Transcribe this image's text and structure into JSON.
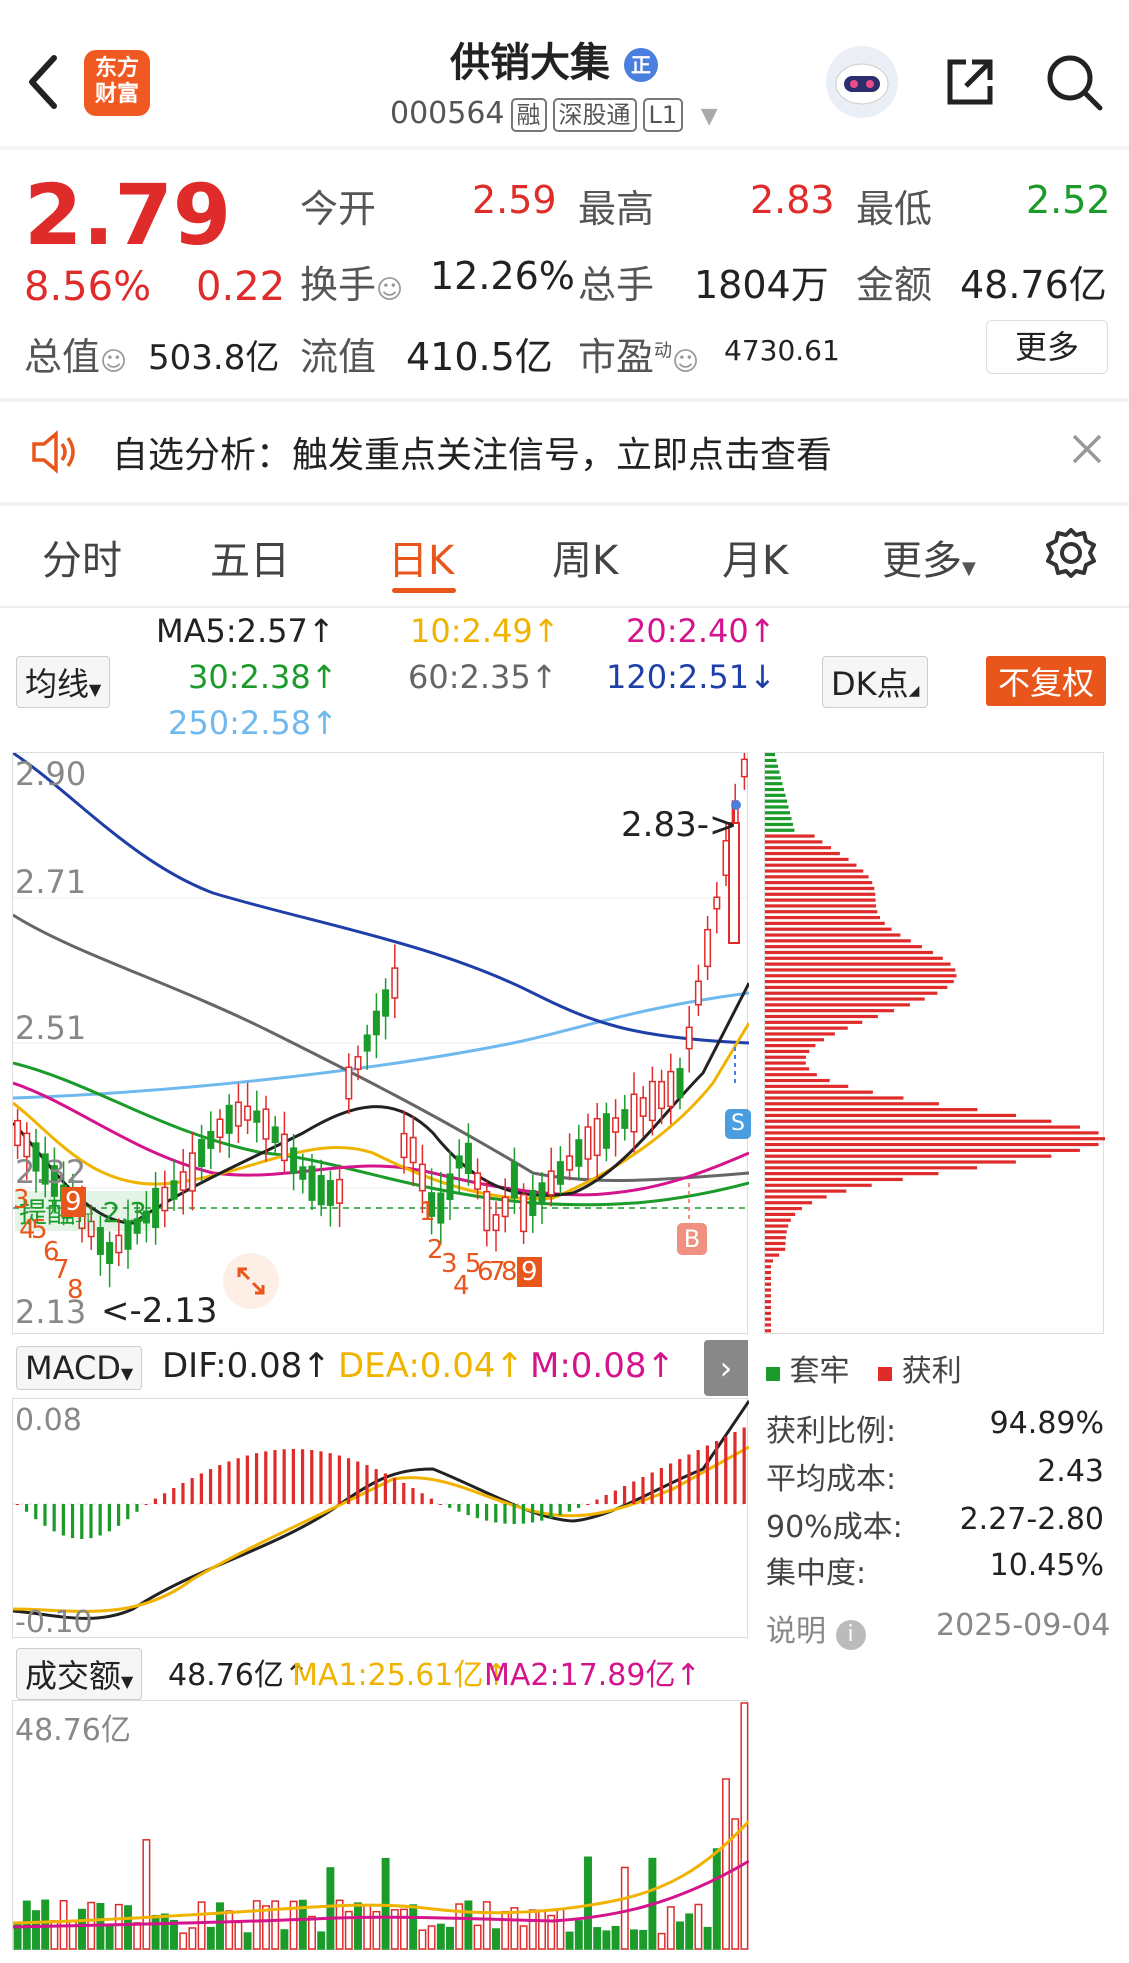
{
  "header": {
    "back_icon": "chevron-left-icon",
    "logo_text_1": "东方",
    "logo_text_2": "财富",
    "title": "供销大集",
    "title_badge": "正",
    "code": "000564",
    "tags": [
      "融",
      "深股通",
      "L1"
    ],
    "share_icon": "share-icon",
    "search_icon": "search-icon"
  },
  "quote": {
    "price": "2.79",
    "change_pct": "8.56%",
    "change": "0.22",
    "open_label": "今开",
    "open": "2.59",
    "high_label": "最高",
    "high": "2.83",
    "low_label": "最低",
    "low": "2.52",
    "turnover_label": "换手",
    "turnover": "12.26%",
    "volume_label": "总手",
    "volume": "1804万",
    "amount_label": "金额",
    "amount": "48.76亿",
    "mktcap_label": "总值",
    "mktcap": "503.8亿",
    "float_label": "流值",
    "float": "410.5亿",
    "pe_label": "市盈",
    "pe_sup": "动",
    "pe": "4730.61",
    "more": "更多"
  },
  "notice": {
    "text": "自选分析：触发重点关注信号，立即点击查看"
  },
  "tabs": [
    "分时",
    "五日",
    "日K",
    "周K",
    "月K",
    "更多"
  ],
  "active_tab": "日K",
  "ma": {
    "selector": "均线",
    "ma5": "MA5:2.57↑",
    "ma10": "10:2.49↑",
    "ma20": "20:2.40↑",
    "ma30": "30:2.38↑",
    "ma60": "60:2.35↑",
    "ma120": "120:2.51↓",
    "ma250": "250:2.58↑",
    "dk": "DK点",
    "fuquan": "不复权"
  },
  "colors": {
    "up": "#e02b2b",
    "down": "#1a9b2a",
    "ma5": "#222222",
    "ma10": "#f0b400",
    "ma20": "#d4148c",
    "ma30": "#1a9b2a",
    "ma60": "#666666",
    "ma120": "#1e3ea8",
    "ma250": "#6fb9ee",
    "accent": "#e8561b"
  },
  "kline": {
    "y_labels": [
      "2.90",
      "2.71",
      "2.51",
      "2.32",
      "2.13"
    ],
    "high_mark": "2.83->",
    "low_mark": "<-2.13",
    "b_badge": "B",
    "s_badge": "S",
    "alert_label": "提醒",
    "alert_value": "2.3",
    "nine_turn_a": [
      "3",
      "4",
      "5",
      "6",
      "7",
      "8",
      "9"
    ],
    "nine_turn_b": [
      "1",
      "2",
      "3",
      "4",
      "5",
      "6",
      "7",
      "8",
      "9"
    ]
  },
  "chip": {
    "legend_trap": "套牢",
    "legend_profit": "获利",
    "profit_ratio_label": "获利比例:",
    "profit_ratio": "94.89%",
    "avg_cost_label": "平均成本:",
    "avg_cost": "2.43",
    "cost90_label": "90%成本:",
    "cost90": "2.27-2.80",
    "concentration_label": "集中度:",
    "concentration": "10.45%",
    "note_label": "说明",
    "date": "2025-09-04"
  },
  "macd": {
    "selector": "MACD",
    "dif": "DIF:0.08↑",
    "dea": "DEA:0.04↑",
    "m": "M:0.08↑",
    "top": "0.08",
    "bottom": "-0.10"
  },
  "vol": {
    "selector": "成交额",
    "value": "48.76亿↑",
    "ma1": "MA1:25.61亿↑",
    "ma2": "MA2:17.89亿↑",
    "top": "48.76亿"
  }
}
